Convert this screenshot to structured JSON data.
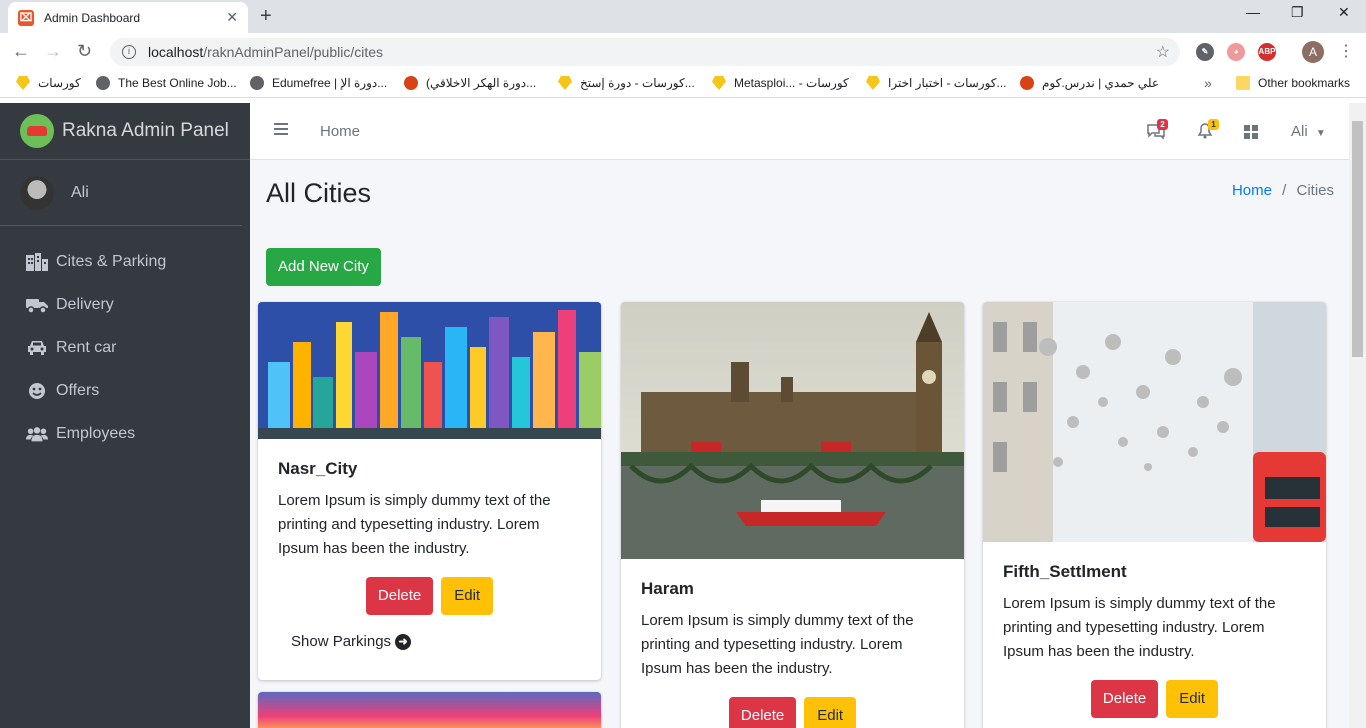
{
  "browser": {
    "tab_title": "Admin Dashboard",
    "url_host": "localhost",
    "url_path": "/raknAdminPanel/public/cites",
    "profile_initial": "A",
    "bookmarks": [
      "كورسات",
      "The Best Online Job...",
      "Edumefree | دورة الإ...",
      "(دورة الهكر الاخلاقي...",
      "كورسات - دورة إستخ...",
      "Metasploi... - كورسات",
      "كورسات - اختبار اخترا...",
      "علي حمدي | ندرس.كوم"
    ],
    "other_bookmarks": "Other bookmarks"
  },
  "sidebar": {
    "brand": "Rakna Admin Panel",
    "user": "Ali",
    "items": [
      {
        "label": "Cites & Parking",
        "icon": "building-icon"
      },
      {
        "label": "Delivery",
        "icon": "truck-icon"
      },
      {
        "label": "Rent car",
        "icon": "car-icon"
      },
      {
        "label": "Offers",
        "icon": "smile-icon"
      },
      {
        "label": "Employees",
        "icon": "users-icon"
      }
    ]
  },
  "header": {
    "home": "Home",
    "messages_count": "2",
    "notifications_count": "1",
    "user": "Ali"
  },
  "page": {
    "title": "All Cities",
    "breadcrumb_home": "Home",
    "breadcrumb_sep": "/",
    "breadcrumb_current": "Cities",
    "add_button": "Add New City"
  },
  "cards": [
    {
      "name": "Nasr_City",
      "text": "Lorem Ipsum is simply dummy text of the printing and typesetting industry. Lorem Ipsum has been the industry.",
      "delete": "Delete",
      "edit": "Edit",
      "show_parkings": "Show Parkings"
    },
    {
      "name": "Haram",
      "text": "Lorem Ipsum is simply dummy text of the printing and typesetting industry. Lorem Ipsum has been the industry.",
      "delete": "Delete",
      "edit": "Edit"
    },
    {
      "name": "Fifth_Settlment",
      "text": "Lorem Ipsum is simply dummy text of the printing and typesetting industry. Lorem Ipsum has been the industry.",
      "delete": "Delete",
      "edit": "Edit"
    }
  ],
  "colors": {
    "sidebar_bg": "#343a40",
    "success": "#28a745",
    "danger": "#dc3545",
    "warning": "#ffc107",
    "link": "#007bff",
    "content_bg": "#f4f6f9"
  }
}
